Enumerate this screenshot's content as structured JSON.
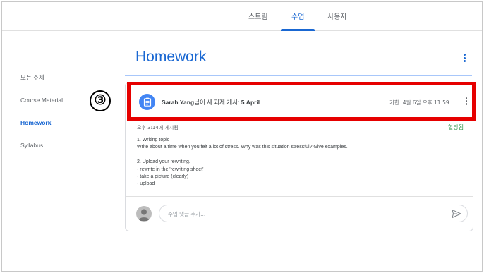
{
  "tabs": [
    {
      "label": "스트림",
      "active": false
    },
    {
      "label": "수업",
      "active": true
    },
    {
      "label": "사용자",
      "active": false
    }
  ],
  "sidebar": {
    "items": [
      {
        "label": "모든 주제",
        "active": false
      },
      {
        "label": "Course Material",
        "active": false
      },
      {
        "label": "Homework",
        "active": true
      },
      {
        "label": "Syllabus",
        "active": false
      }
    ]
  },
  "section": {
    "title": "Homework",
    "menu_icon": "more-vertical-icon"
  },
  "callout": {
    "number": "③"
  },
  "post": {
    "icon": "assignment-icon",
    "author": "Sarah Yang",
    "action": "님이 새 과제 게시: ",
    "topic": "5 April",
    "due": "기한: 4월 6일 오후 11:59",
    "posted_time": "오후 3:14에 게시됨",
    "status": "할당됨",
    "body": "1. Writing topic\nWrite about a time when you felt a lot of stress. Why was this situation stressful? Give examples.\n\n2. Upload your rewriting.\n- rewrite in the 'rewriting sheet'\n- take a picture (clearly)\n- upload",
    "menu_icon": "more-vertical-icon"
  },
  "comment": {
    "placeholder": "수업 댓글 추가...",
    "send_icon": "send-icon",
    "avatar_icon": "user-avatar-icon"
  },
  "colors": {
    "accent": "#1967d2",
    "highlight": "#e60000",
    "status": "#1e8e3e",
    "assignment": "#4285f4"
  }
}
